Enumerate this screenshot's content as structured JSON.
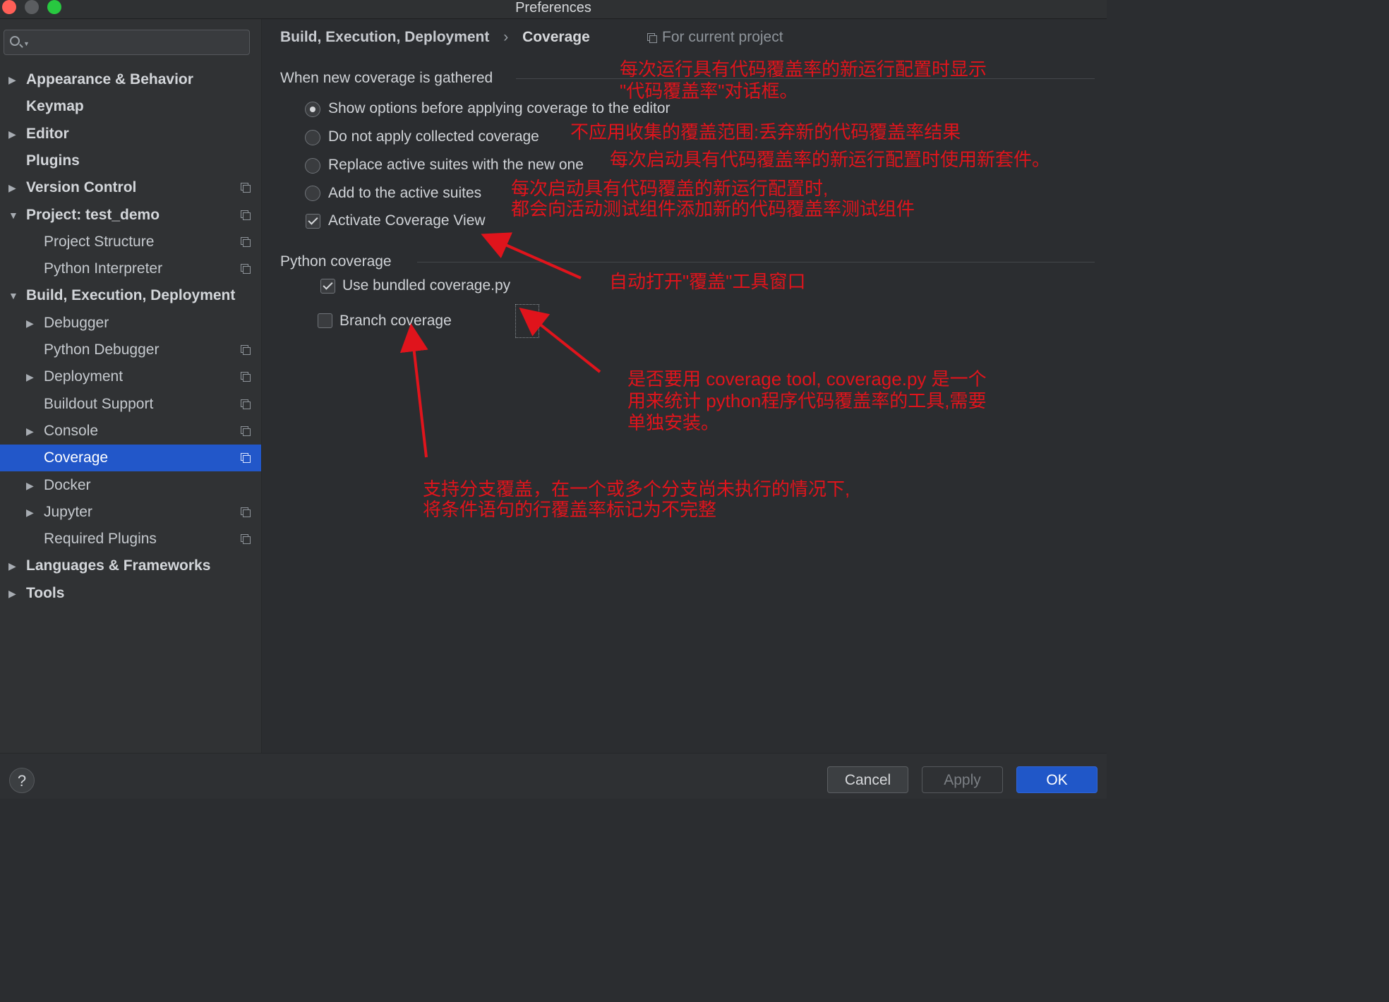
{
  "window": {
    "title": "Preferences",
    "traffic_colors": {
      "close": "#ff5f57",
      "minimize": "#5b5d60",
      "maximize": "#28c840"
    }
  },
  "sidebar": {
    "search_placeholder": "",
    "items": [
      {
        "label": "Appearance & Behavior",
        "level": 0,
        "bold": true,
        "arrow": "right"
      },
      {
        "label": "Keymap",
        "level": 0,
        "bold": true,
        "arrow": ""
      },
      {
        "label": "Editor",
        "level": 0,
        "bold": true,
        "arrow": "right"
      },
      {
        "label": "Plugins",
        "level": 0,
        "bold": true,
        "arrow": ""
      },
      {
        "label": "Version Control",
        "level": 0,
        "bold": true,
        "arrow": "right",
        "project_icon": true
      },
      {
        "label": "Project: test_demo",
        "level": 0,
        "bold": true,
        "arrow": "down",
        "project_icon": true
      },
      {
        "label": "Project Structure",
        "level": 1,
        "bold": false,
        "arrow": "",
        "project_icon": true
      },
      {
        "label": "Python Interpreter",
        "level": 1,
        "bold": false,
        "arrow": "",
        "project_icon": true
      },
      {
        "label": "Build, Execution, Deployment",
        "level": 0,
        "bold": true,
        "arrow": "down"
      },
      {
        "label": "Debugger",
        "level": 1,
        "bold": false,
        "arrow": "right"
      },
      {
        "label": "Python Debugger",
        "level": 1,
        "bold": false,
        "arrow": "",
        "project_icon": true
      },
      {
        "label": "Deployment",
        "level": 1,
        "bold": false,
        "arrow": "right",
        "project_icon": true
      },
      {
        "label": "Buildout Support",
        "level": 1,
        "bold": false,
        "arrow": "",
        "project_icon": true
      },
      {
        "label": "Console",
        "level": 1,
        "bold": false,
        "arrow": "right",
        "project_icon": true
      },
      {
        "label": "Coverage",
        "level": 1,
        "bold": false,
        "arrow": "",
        "project_icon": true,
        "selected": true
      },
      {
        "label": "Docker",
        "level": 1,
        "bold": false,
        "arrow": "right"
      },
      {
        "label": "Jupyter",
        "level": 1,
        "bold": false,
        "arrow": "right",
        "project_icon": true
      },
      {
        "label": "Required Plugins",
        "level": 1,
        "bold": false,
        "arrow": "",
        "project_icon": true
      },
      {
        "label": "Languages & Frameworks",
        "level": 0,
        "bold": true,
        "arrow": "right"
      },
      {
        "label": "Tools",
        "level": 0,
        "bold": true,
        "arrow": "right"
      }
    ]
  },
  "breadcrumb": {
    "parent": "Build, Execution, Deployment",
    "separator": "›",
    "current": "Coverage",
    "scope": "For current project"
  },
  "coverage": {
    "section_title": "When new coverage is gathered",
    "options": [
      {
        "label": "Show options before applying coverage to the editor",
        "type": "radio",
        "checked": true
      },
      {
        "label": "Do not apply collected coverage",
        "type": "radio",
        "checked": false
      },
      {
        "label": "Replace active suites with the new one",
        "type": "radio",
        "checked": false
      },
      {
        "label": "Add to the active suites",
        "type": "radio",
        "checked": false
      },
      {
        "label": "Activate Coverage View",
        "type": "checkbox",
        "checked": true
      }
    ]
  },
  "python_coverage": {
    "section_title": "Python coverage",
    "use_bundled": {
      "label": "Use bundled coverage.py",
      "checked": true
    },
    "branch": {
      "label": "Branch coverage",
      "checked": false
    }
  },
  "annotations": {
    "color": "#e0141c",
    "show_options_line1": "每次运行具有代码覆盖率的新运行配置时显示",
    "show_options_line2": "\"代码覆盖率\"对话框。",
    "do_not_apply": "不应用收集的覆盖范围:丢弃新的代码覆盖率结果",
    "replace": "每次启动具有代码覆盖率的新运行配置时使用新套件。",
    "add_line1": "每次启动具有代码覆盖的新运行配置时,",
    "add_line2": "都会向活动测试组件添加新的代码覆盖率测试组件",
    "activate_view": "自动打开\"覆盖\"工具窗口",
    "bundled_line1": "是否要用 coverage tool, coverage.py 是一个",
    "bundled_line2": "用来统计 python程序代码覆盖率的工具,需要",
    "bundled_line3": "单独安装。",
    "branch_line1": "支持分支覆盖，在一个或多个分支尚未执行的情况下,",
    "branch_line2": "将条件语句的行覆盖率标记为不完整"
  },
  "footer": {
    "help": "?",
    "cancel": "Cancel",
    "apply": "Apply",
    "ok": "OK",
    "accent": "#2057c8"
  }
}
